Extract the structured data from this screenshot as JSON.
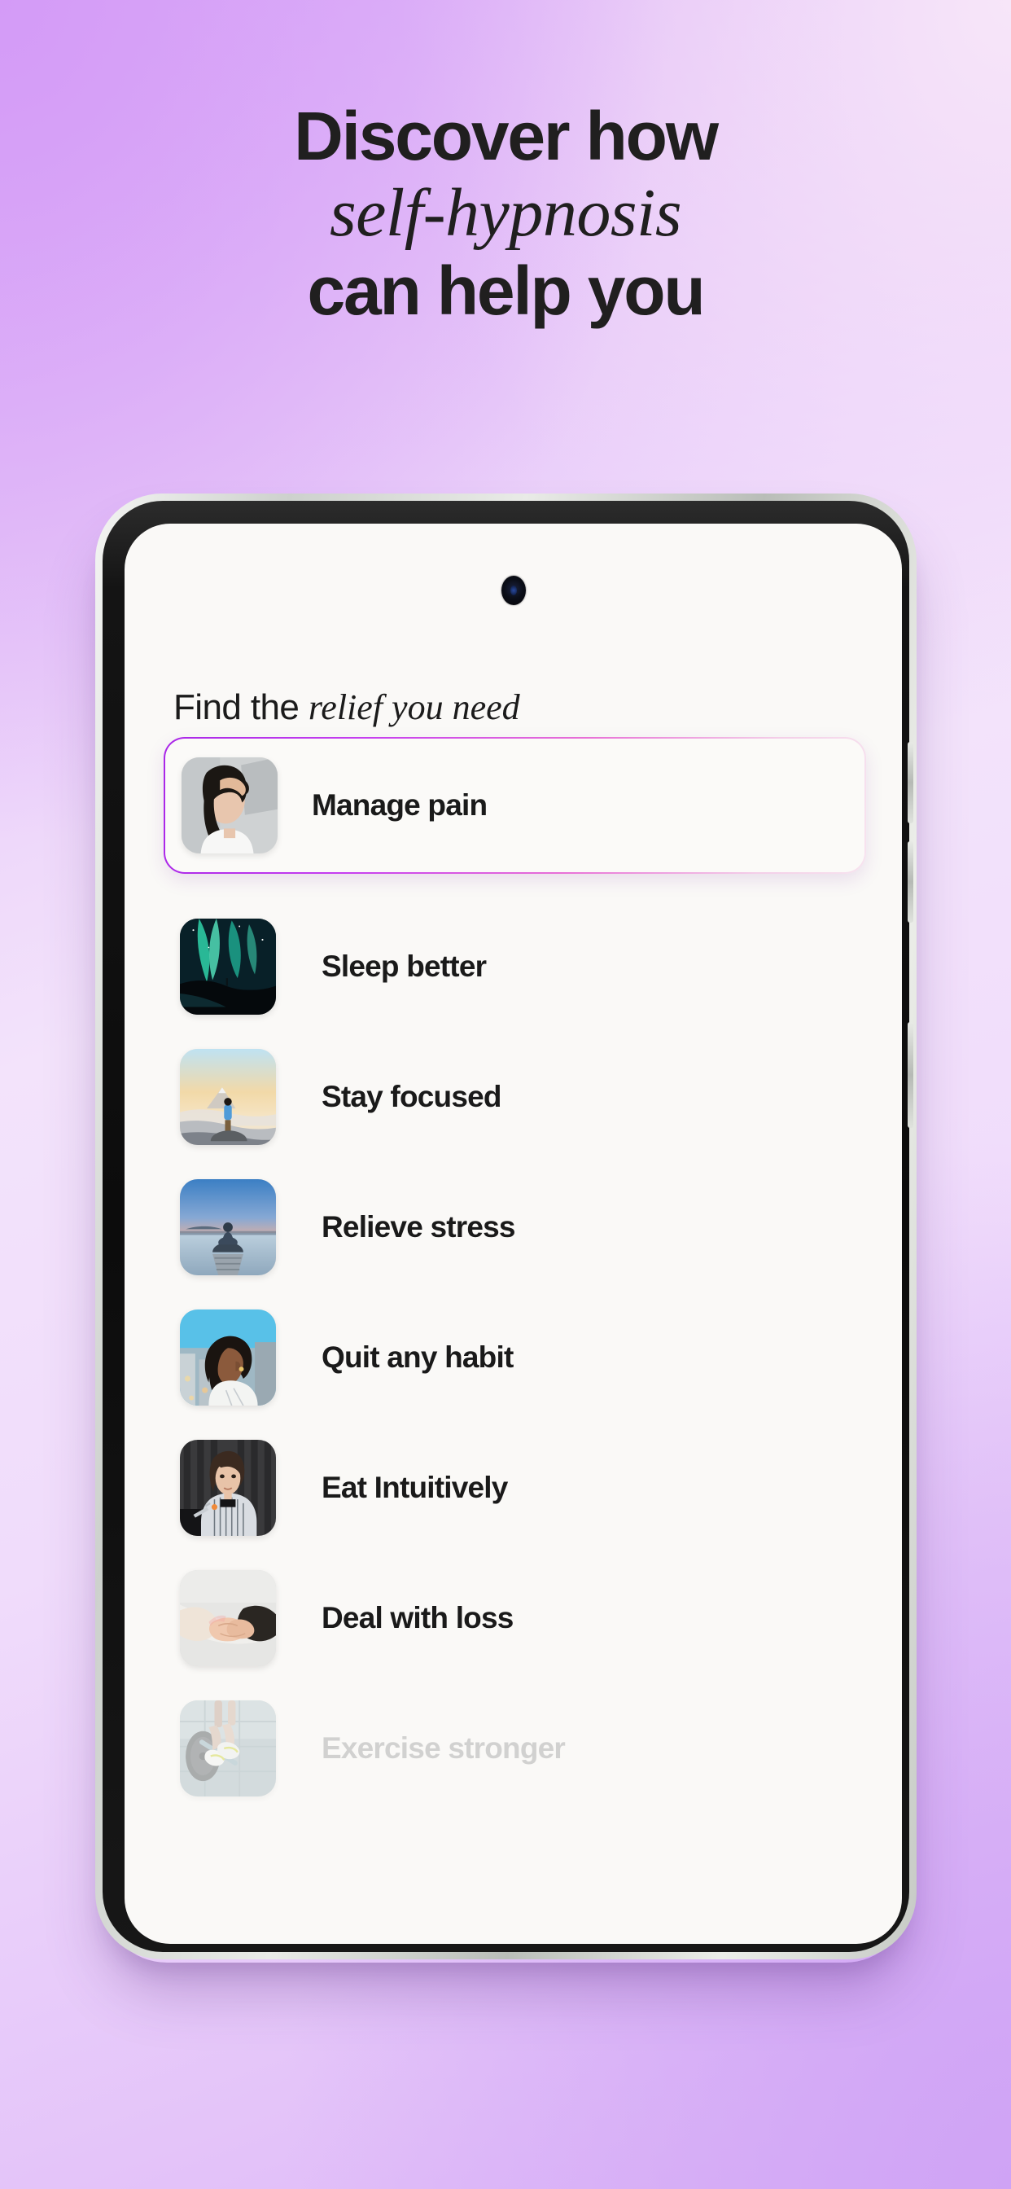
{
  "background": {
    "gradient_from": "#dcb0f7",
    "gradient_mid": "#f3e3fb",
    "gradient_to": "#ddb6f8"
  },
  "headline": {
    "line1": "Discover how",
    "line2": "self-hypnosis",
    "line3": "can help you"
  },
  "phone": {
    "device": "android-smartphone",
    "camera": "punch-hole-camera",
    "buttons": [
      "volume-up",
      "volume-down",
      "power"
    ]
  },
  "screen": {
    "title_plain": "Find the ",
    "title_italic": "relief you need",
    "selected_index": 0,
    "accent": "#c63ef0",
    "surface": "#faf9f7",
    "items": [
      {
        "label": "Manage pain",
        "image": "woman-hand-on-forehead",
        "selected": true,
        "faded": false
      },
      {
        "label": "Sleep better",
        "image": "aurora-night-sky",
        "selected": false,
        "faded": false
      },
      {
        "label": "Stay focused",
        "image": "man-on-mountain-sunrise",
        "selected": false,
        "faded": false
      },
      {
        "label": "Relieve stress",
        "image": "person-meditating-on-dock",
        "selected": false,
        "faded": false
      },
      {
        "label": "Quit any habit",
        "image": "woman-city-rooftop",
        "selected": false,
        "faded": false
      },
      {
        "label": "Eat Intuitively",
        "image": "woman-eating-with-fork",
        "selected": false,
        "faded": false
      },
      {
        "label": "Deal with loss",
        "image": "two-hands-holding",
        "selected": false,
        "faded": false
      },
      {
        "label": "Exercise stronger",
        "image": "barbell-lifting-legs",
        "selected": false,
        "faded": true
      }
    ]
  }
}
